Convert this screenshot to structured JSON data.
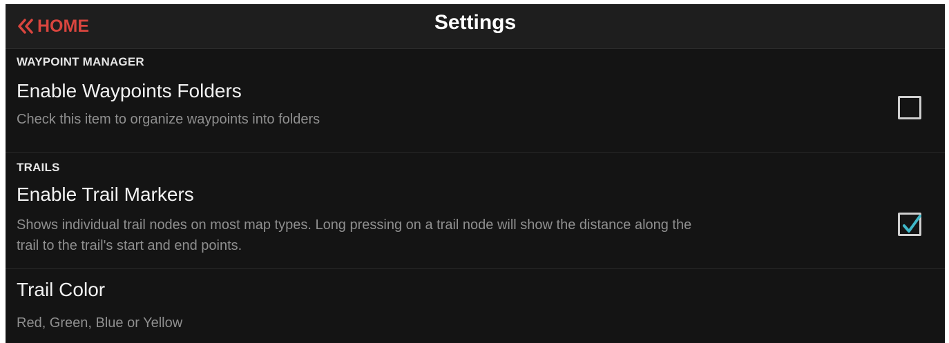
{
  "header": {
    "back_label": "HOME",
    "title": "Settings"
  },
  "sections": [
    {
      "header": "WAYPOINT MANAGER",
      "items": [
        {
          "title": "Enable Waypoints Folders",
          "subtitle": "Check this item to organize waypoints into folders",
          "checked": false
        }
      ]
    },
    {
      "header": "TRAILS",
      "items": [
        {
          "title": "Enable Trail Markers",
          "subtitle_line1": "Shows individual trail nodes on most map types. Long pressing on a trail node will show the distance along the",
          "subtitle_line2": "trail to the trail's start and end points.",
          "checked": true
        },
        {
          "title": "Trail Color",
          "subtitle": "Red, Green, Blue or Yellow"
        }
      ]
    }
  ],
  "colors": {
    "accent": "#d9453e",
    "check": "#3fb8c9",
    "background": "#141414"
  },
  "icons": {
    "back": "double-chevron-left-icon",
    "checkbox_unchecked": "checkbox-unchecked-icon",
    "checkbox_checked": "checkbox-checked-icon"
  }
}
